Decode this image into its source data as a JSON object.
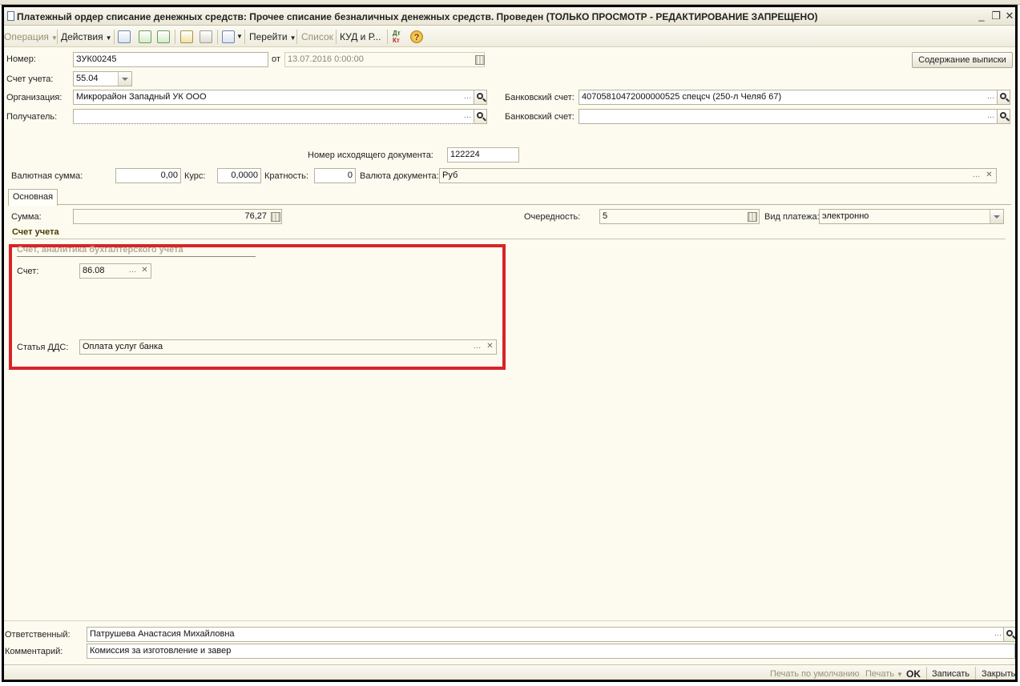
{
  "window": {
    "title": "Платежный ордер списание денежных средств: Прочее списание безналичных денежных средств. Проведен (ТОЛЬКО ПРОСМОТР - РЕДАКТИРОВАНИЕ ЗАПРЕЩЕНО)",
    "controls": {
      "minimize": "_",
      "restore": "❐",
      "close": "✕"
    }
  },
  "toolbar": {
    "operation": "Операция",
    "actions": "Действия",
    "goto": "Перейти",
    "list": "Список",
    "kud": "КУД и Р...",
    "dtkt_top": "Дт",
    "dtkt_bottom": "Кт",
    "help": "?",
    "icons": [
      "document-icon",
      "structure-icon",
      "copy-icon",
      "post-icon",
      "print-icon",
      "arrow-icon"
    ]
  },
  "header": {
    "number_label": "Номер:",
    "number_value": "ЗУК00245",
    "date_sep": "от",
    "date_value": "13.07.2016  0:00:00",
    "statement_button": "Содержание выписки",
    "account_label": "Счет учета:",
    "account_value": "55.04",
    "org_label": "Организация:",
    "org_value": "Микрорайон Западный УК ООО",
    "bank_account_label": "Банковский счет:",
    "bank_account_value": "40705810472000000525 спецсч (250-л Челяб 67)",
    "recipient_label": "Получатель:",
    "recipient_value": "",
    "recipient_bank_label": "Банковский счет:",
    "recipient_bank_value": "",
    "outgoing_label": "Номер исходящего документа:",
    "outgoing_value": "122224",
    "currency_sum_label": "Валютная сумма:",
    "currency_sum_value": "0,00",
    "rate_label": "Курс:",
    "rate_value": "0,0000",
    "multiplicity_label": "Кратность:",
    "multiplicity_value": "0",
    "doc_currency_label": "Валюта документа:",
    "doc_currency_value": "Руб"
  },
  "tab": {
    "main": "Основная"
  },
  "main": {
    "sum_label": "Сумма:",
    "sum_value": "76,27",
    "priority_label": "Очередность:",
    "priority_value": "5",
    "payment_type_label": "Вид платежа:",
    "payment_type_value": "электронно",
    "section_title": "Счет учета",
    "group_title": "Счет, аналитика бухгалтерского учета",
    "account_label": "Счет:",
    "account_value": "86.08",
    "dds_label": "Статья ДДС:",
    "dds_value": "Оплата услуг банка"
  },
  "footer": {
    "responsible_label": "Ответственный:",
    "responsible_value": "Патрушева Анастасия Михайловна",
    "comment_label": "Комментарий:",
    "comment_value": "Комиссия за изготовление и завер"
  },
  "statusbar": {
    "print_default": "Печать по умолчанию",
    "print": "Печать",
    "ok": "OK",
    "save": "Записать",
    "close": "Закрыть"
  },
  "colors": {
    "highlight_box": "#d8232a",
    "form_background": "#fdfbf0"
  }
}
